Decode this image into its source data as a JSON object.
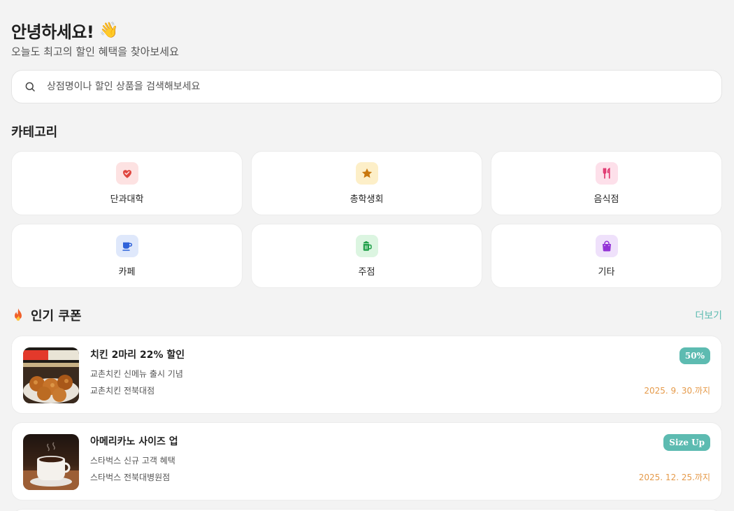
{
  "header": {
    "greeting": "안녕하세요!",
    "wave_emoji": "👋",
    "subtitle": "오늘도 최고의 할인 혜택을 찾아보세요"
  },
  "search": {
    "placeholder": "상점명이나 할인 상품을 검색해보세요",
    "icon": "search-icon"
  },
  "categories": {
    "title": "카테고리",
    "items": [
      {
        "label": "단과대학",
        "icon": "heart-handshake-icon",
        "bg": "#fde2e2",
        "fg": "#e0463f"
      },
      {
        "label": "총학생회",
        "icon": "star-icon",
        "bg": "#fdefc8",
        "fg": "#c9780e"
      },
      {
        "label": "음식점",
        "icon": "utensils-icon",
        "bg": "#fde0ea",
        "fg": "#e0366e"
      },
      {
        "label": "카페",
        "icon": "coffee-icon",
        "bg": "#dfe8fb",
        "fg": "#2f62d9"
      },
      {
        "label": "주점",
        "icon": "beer-icon",
        "bg": "#dcf5e1",
        "fg": "#22a04b"
      },
      {
        "label": "기타",
        "icon": "shopping-bag-icon",
        "bg": "#efe1fb",
        "fg": "#9333d6"
      }
    ]
  },
  "popular": {
    "title": "인기 쿠폰",
    "fire_emoji": "🔥",
    "more_label": "더보기",
    "coupons": [
      {
        "title": "치킨 2마리 22% 할인",
        "description": "교촌치킨 신메뉴 출시 기념",
        "store": "교촌치킨 전북대점",
        "badge": "50%",
        "expiry": "2025. 9. 30.까지",
        "image": "fried-chicken-image"
      },
      {
        "title": "아메리카노 사이즈 업",
        "description": "스타벅스 신규 고객 혜택",
        "store": "스타벅스 전북대병원점",
        "badge": "Size Up",
        "expiry": "2025. 12. 25.까지",
        "image": "americano-image"
      }
    ]
  },
  "colors": {
    "accent": "#5dbbb1",
    "expiry": "#e59a4a",
    "background": "#f3f3f3"
  }
}
